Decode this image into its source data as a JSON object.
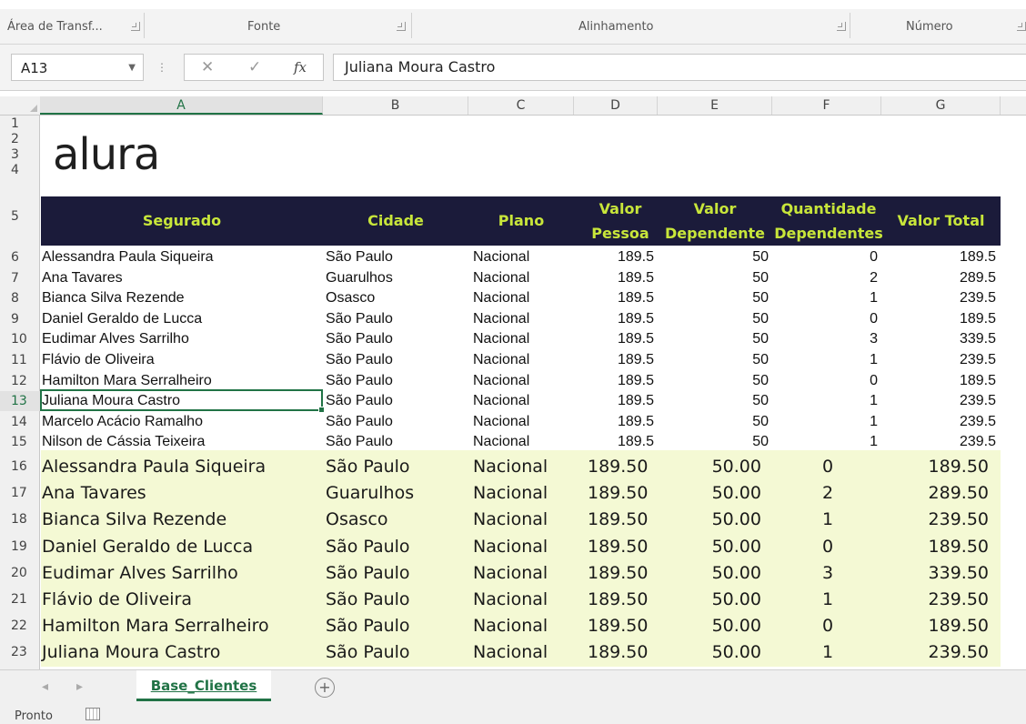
{
  "ribbon": {
    "groups": [
      {
        "label": "Área de Transf..."
      },
      {
        "label": "Fonte"
      },
      {
        "label": "Alinhamento"
      },
      {
        "label": "Número"
      }
    ]
  },
  "formula_bar": {
    "name_box": "A13",
    "fx_label": "fx",
    "content": "Juliana Moura Castro"
  },
  "columns": [
    "A",
    "B",
    "C",
    "D",
    "E",
    "F",
    "G"
  ],
  "active_column": "A",
  "active_row": "13",
  "logo_text": "alura",
  "table_header": {
    "segurado": "Segurado",
    "cidade": "Cidade",
    "plano": "Plano",
    "valor_pessoa_1": "Valor",
    "valor_pessoa_2": "Pessoa",
    "valor_dep_1": "Valor",
    "valor_dep_2": "Dependente",
    "qtd_1": "Quantidade",
    "qtd_2": "Dependentes",
    "valor_total": "Valor Total"
  },
  "rows_raw": [
    {
      "row": "6",
      "name": "Alessandra Paula Siqueira",
      "city": "São Paulo",
      "plan": "Nacional",
      "vp": "189.5",
      "vd": "50",
      "qd": "0",
      "vt": "189.5"
    },
    {
      "row": "7",
      "name": "Ana Tavares",
      "city": "Guarulhos",
      "plan": "Nacional",
      "vp": "189.5",
      "vd": "50",
      "qd": "2",
      "vt": "289.5"
    },
    {
      "row": "8",
      "name": "Bianca Silva Rezende",
      "city": "Osasco",
      "plan": "Nacional",
      "vp": "189.5",
      "vd": "50",
      "qd": "1",
      "vt": "239.5"
    },
    {
      "row": "9",
      "name": "Daniel Geraldo de Lucca",
      "city": "São Paulo",
      "plan": "Nacional",
      "vp": "189.5",
      "vd": "50",
      "qd": "0",
      "vt": "189.5"
    },
    {
      "row": "10",
      "name": "Eudimar Alves Sarrilho",
      "city": "São Paulo",
      "plan": "Nacional",
      "vp": "189.5",
      "vd": "50",
      "qd": "3",
      "vt": "339.5"
    },
    {
      "row": "11",
      "name": "Flávio de Oliveira",
      "city": "São Paulo",
      "plan": "Nacional",
      "vp": "189.5",
      "vd": "50",
      "qd": "1",
      "vt": "239.5"
    },
    {
      "row": "12",
      "name": "Hamilton Mara Serralheiro",
      "city": "São Paulo",
      "plan": "Nacional",
      "vp": "189.5",
      "vd": "50",
      "qd": "0",
      "vt": "189.5"
    },
    {
      "row": "13",
      "name": "Juliana Moura Castro",
      "city": "São Paulo",
      "plan": "Nacional",
      "vp": "189.5",
      "vd": "50",
      "qd": "1",
      "vt": "239.5"
    },
    {
      "row": "14",
      "name": "Marcelo Acácio Ramalho",
      "city": "São Paulo",
      "plan": "Nacional",
      "vp": "189.5",
      "vd": "50",
      "qd": "1",
      "vt": "239.5"
    },
    {
      "row": "15",
      "name": "Nilson de Cássia Teixeira",
      "city": "São Paulo",
      "plan": "Nacional",
      "vp": "189.5",
      "vd": "50",
      "qd": "1",
      "vt": "239.5"
    }
  ],
  "rows_formatted": [
    {
      "row": "16",
      "name": "Alessandra Paula Siqueira",
      "city": "São Paulo",
      "plan": "Nacional",
      "vp": "189.50",
      "vd": "50.00",
      "qd": "0",
      "vt": "189.50"
    },
    {
      "row": "17",
      "name": "Ana Tavares",
      "city": "Guarulhos",
      "plan": "Nacional",
      "vp": "189.50",
      "vd": "50.00",
      "qd": "2",
      "vt": "289.50"
    },
    {
      "row": "18",
      "name": "Bianca Silva Rezende",
      "city": "Osasco",
      "plan": "Nacional",
      "vp": "189.50",
      "vd": "50.00",
      "qd": "1",
      "vt": "239.50"
    },
    {
      "row": "19",
      "name": "Daniel Geraldo de Lucca",
      "city": "São Paulo",
      "plan": "Nacional",
      "vp": "189.50",
      "vd": "50.00",
      "qd": "0",
      "vt": "189.50"
    },
    {
      "row": "20",
      "name": "Eudimar Alves Sarrilho",
      "city": "São Paulo",
      "plan": "Nacional",
      "vp": "189.50",
      "vd": "50.00",
      "qd": "3",
      "vt": "339.50"
    },
    {
      "row": "21",
      "name": "Flávio de Oliveira",
      "city": "São Paulo",
      "plan": "Nacional",
      "vp": "189.50",
      "vd": "50.00",
      "qd": "1",
      "vt": "239.50"
    },
    {
      "row": "22",
      "name": "Hamilton Mara Serralheiro",
      "city": "São Paulo",
      "plan": "Nacional",
      "vp": "189.50",
      "vd": "50.00",
      "qd": "0",
      "vt": "189.50"
    },
    {
      "row": "23",
      "name": "Juliana Moura Castro",
      "city": "São Paulo",
      "plan": "Nacional",
      "vp": "189.50",
      "vd": "50.00",
      "qd": "1",
      "vt": "239.50"
    }
  ],
  "empty_row_labels": [
    "1",
    "2",
    "3",
    "4",
    "5"
  ],
  "sheet_tab": "Base_Clientes",
  "status_text": "Pronto",
  "colors": {
    "accent": "#217346",
    "header_bg": "#1b1b3a",
    "header_text": "#c8e63a",
    "band_bg": "#f4f9d4"
  }
}
